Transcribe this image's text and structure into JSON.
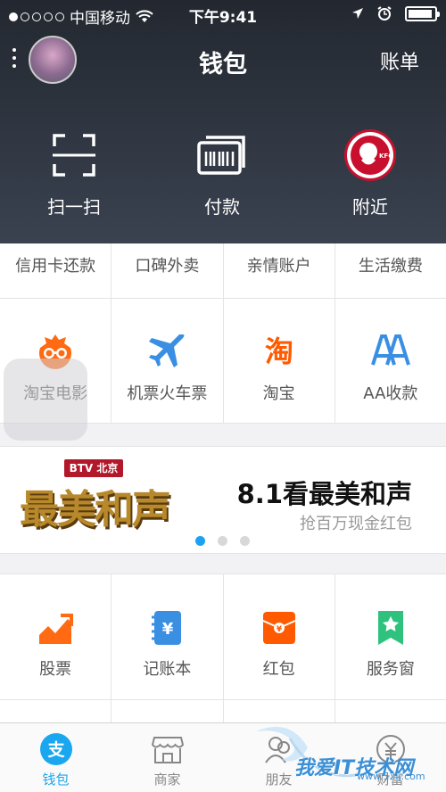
{
  "status": {
    "carrier": "中国移动",
    "time": "下午9:41"
  },
  "nav": {
    "title": "钱包",
    "right_label": "账单"
  },
  "quick_actions": [
    {
      "label": "扫一扫",
      "icon": "scan-icon"
    },
    {
      "label": "付款",
      "icon": "barcode-pay-icon"
    },
    {
      "label": "附近",
      "icon": "kfc-logo-icon"
    }
  ],
  "text_row": [
    "信用卡还款",
    "口碑外卖",
    "亲情账户",
    "生活缴费"
  ],
  "icon_row1": [
    {
      "label": "淘宝电影",
      "icon": "movie-glasses-icon",
      "color": "#ff6a13"
    },
    {
      "label": "机票火车票",
      "icon": "airplane-icon",
      "color": "#3a8fe3"
    },
    {
      "label": "淘宝",
      "icon": "taobao-icon",
      "color": "#ff5a00"
    },
    {
      "label": "AA收款",
      "icon": "aa-collect-icon",
      "color": "#3a8fe3"
    }
  ],
  "banner": {
    "logo": "BTV 北京卫视",
    "art_title": "最美和声",
    "headline": "8.1看最美和声",
    "subtitle": "抢百万现金红包",
    "page_active": 1,
    "page_count": 3
  },
  "icon_row2": [
    {
      "label": "股票",
      "icon": "stock-chart-icon",
      "color": "#ff6a13"
    },
    {
      "label": "记账本",
      "icon": "ledger-icon",
      "color": "#3a8fe3"
    },
    {
      "label": "红包",
      "icon": "red-envelope-icon",
      "color": "#ff5a00"
    },
    {
      "label": "服务窗",
      "icon": "service-window-icon",
      "color": "#2ec27e"
    }
  ],
  "tabs": [
    {
      "label": "钱包",
      "icon": "wallet-tab-icon",
      "active": true
    },
    {
      "label": "商家",
      "icon": "store-tab-icon",
      "active": false
    },
    {
      "label": "朋友",
      "icon": "friends-tab-icon",
      "active": false
    },
    {
      "label": "财富",
      "icon": "wealth-tab-icon",
      "active": false
    }
  ],
  "watermark": {
    "text": "我爱IT技术网",
    "url": "www.52ij.com"
  },
  "colors": {
    "accent": "#1aa7f0",
    "header_bg": "#2e343f"
  }
}
